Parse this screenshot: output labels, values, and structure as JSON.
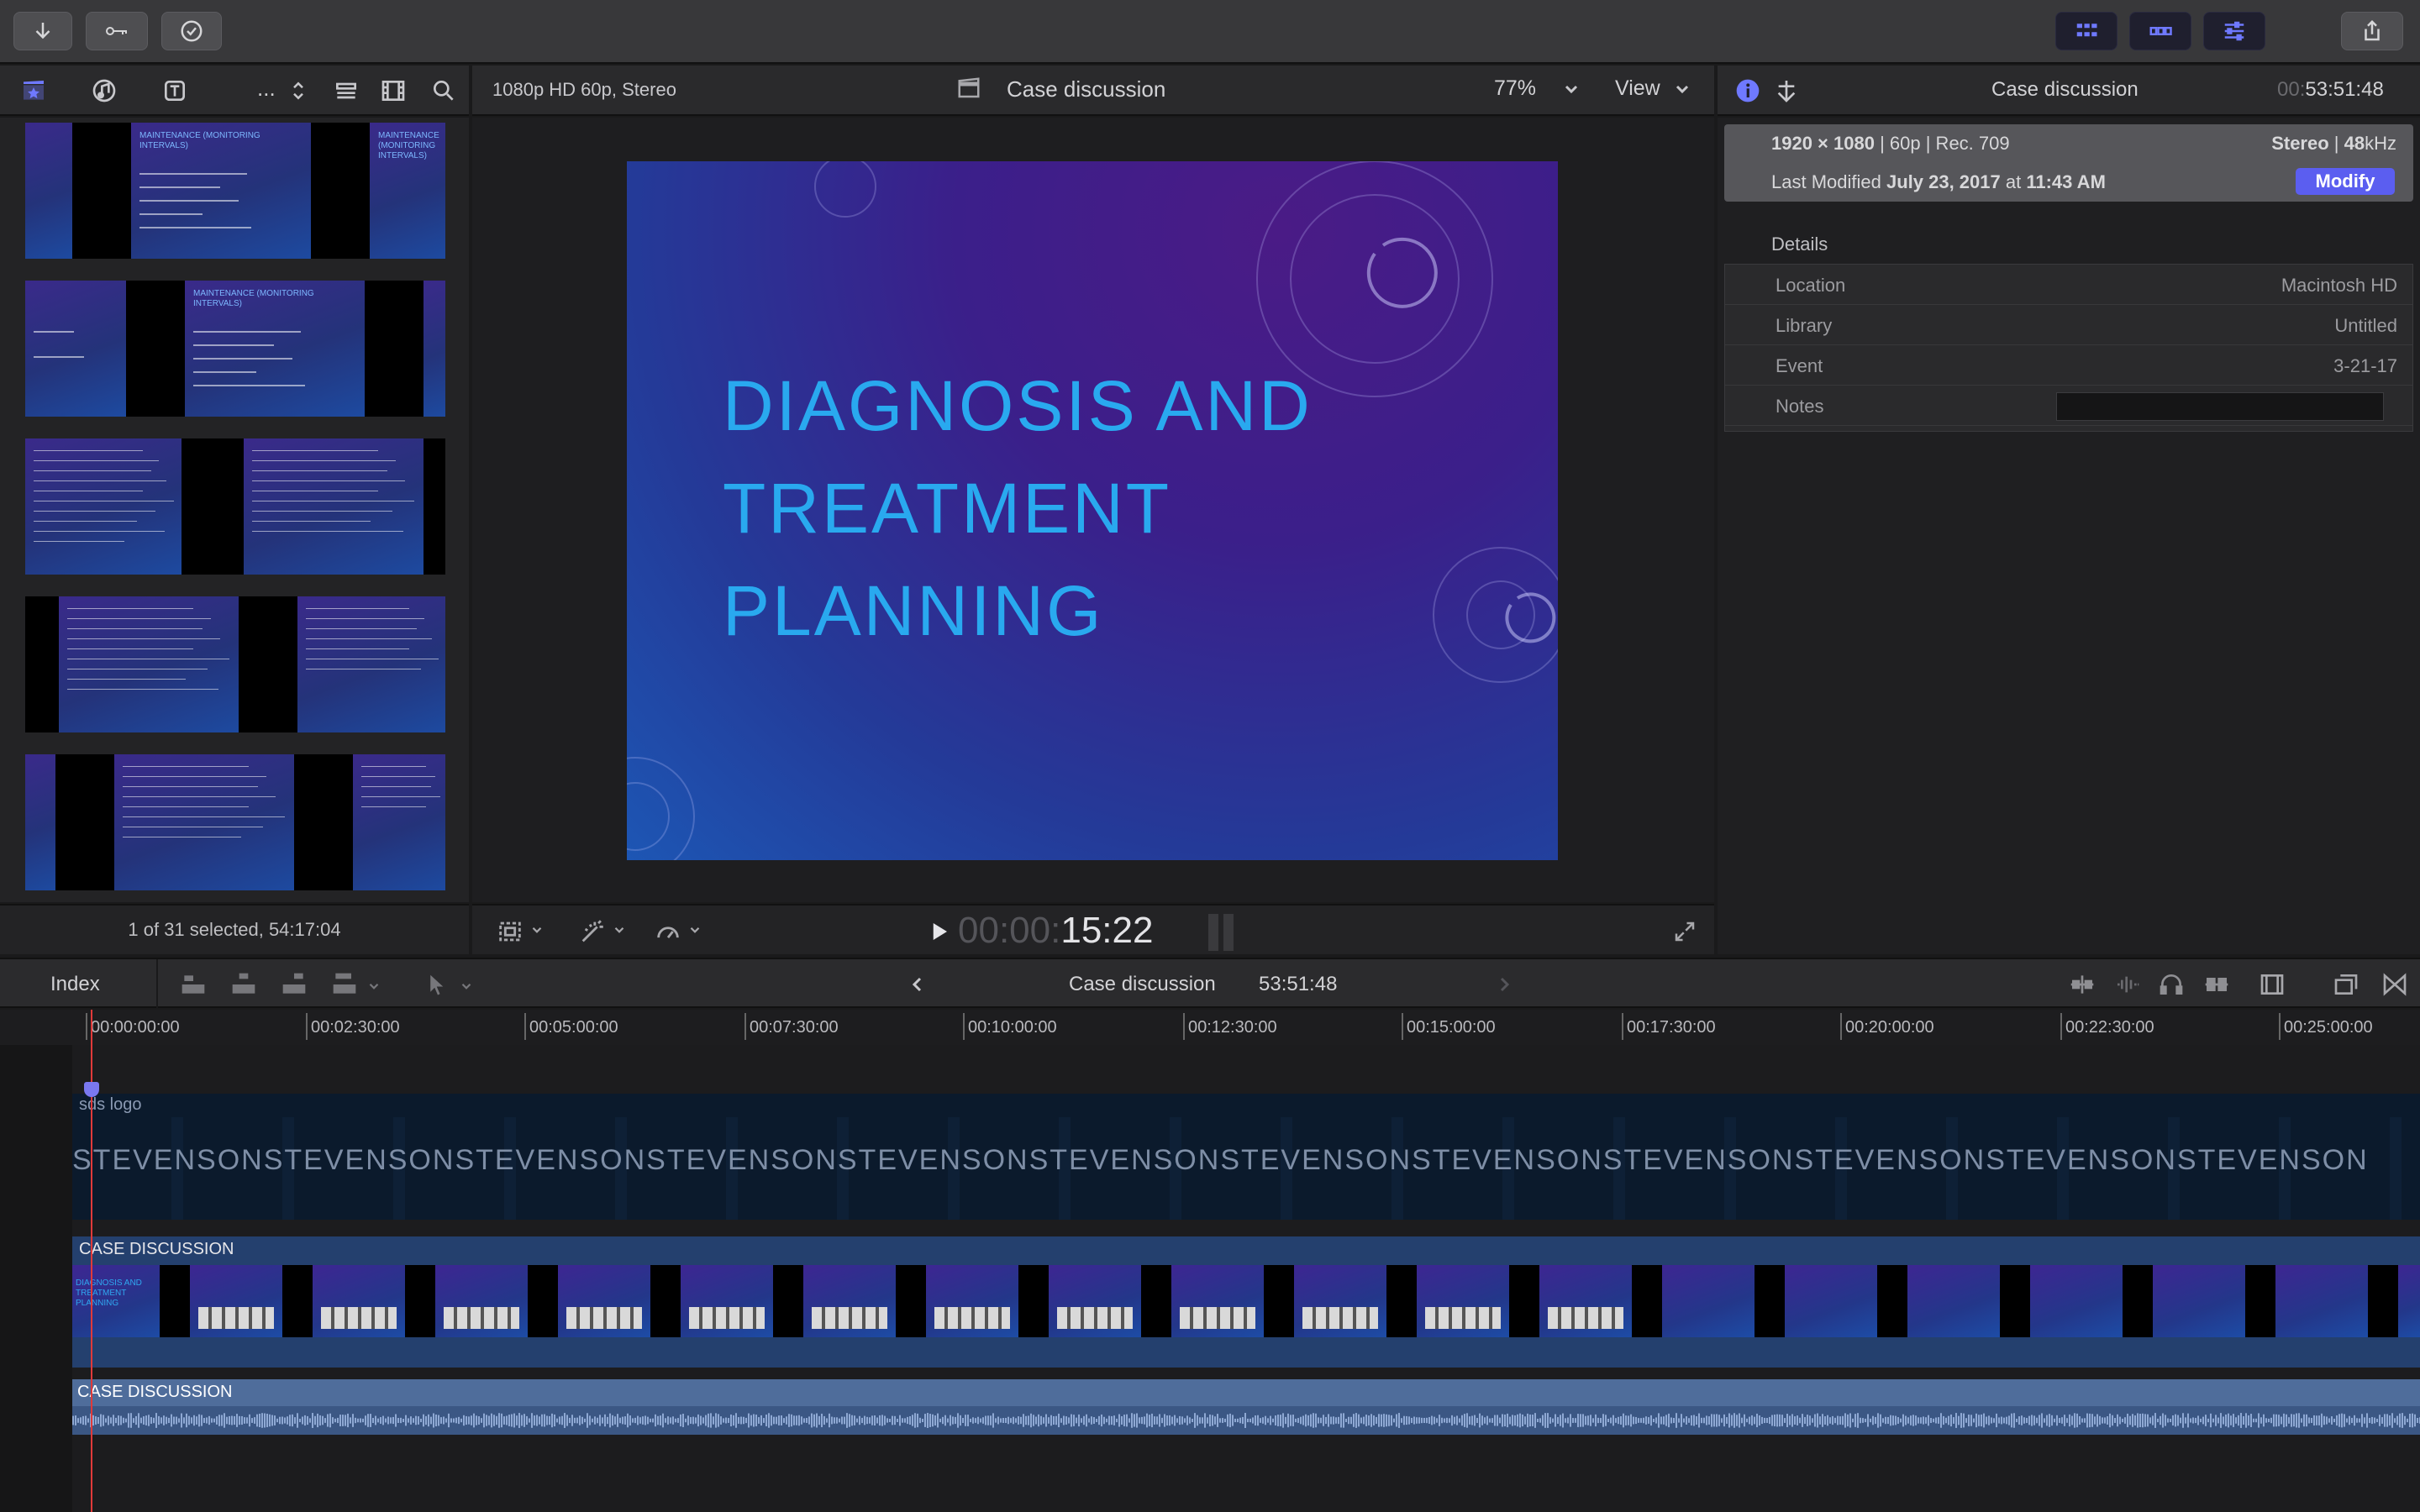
{
  "browser": {
    "status": "1 of 31 selected, 54:17:04",
    "more_label": "...",
    "thumbs": [
      {
        "title": "MAINTENANCE (MONITORING INTERVALS)"
      },
      {
        "title": "MAINTENANCE (MONITORING INTERVALS)"
      },
      {
        "title": ""
      },
      {
        "title": ""
      },
      {
        "title": ""
      }
    ]
  },
  "viewer": {
    "format": "1080p HD 60p, Stereo",
    "title": "Case discussion",
    "zoom": "77%",
    "view_label": "View",
    "slide_title_lines": [
      "DIAGNOSIS AND",
      "TREATMENT",
      "PLANNING"
    ],
    "timecode_dim": "00:00:",
    "timecode_main": "15:22"
  },
  "inspector": {
    "title": "Case discussion",
    "duration_dim": "00:",
    "duration_main": "53:51:48",
    "resolution": "1920 × 1080",
    "frame_info": " | 60p | Rec. 709",
    "audio_main": "Stereo",
    "audio_sep": " | ",
    "audio_rate": "48",
    "audio_unit": "kHz",
    "modified_label": "Last Modified ",
    "modified_date": "July 23, 2017",
    "modified_at": " at ",
    "modified_time": "11:43 AM",
    "modify_button": "Modify",
    "details_heading": "Details",
    "details": [
      {
        "key": "Location",
        "value": "Macintosh HD"
      },
      {
        "key": "Library",
        "value": "Untitled"
      },
      {
        "key": "Event",
        "value": "3-21-17"
      },
      {
        "key": "Notes",
        "value": ""
      }
    ]
  },
  "timeline": {
    "index_label": "Index",
    "project_name": "Case discussion",
    "project_duration": "53:51:48",
    "ruler_ticks": [
      "00:00:00:00",
      "00:02:30:00",
      "00:05:00:00",
      "00:07:30:00",
      "00:10:00:00",
      "00:12:30:00",
      "00:15:00:00",
      "00:17:30:00",
      "00:20:00:00",
      "00:22:30:00",
      "00:25:00:00"
    ],
    "logo_lane_label": "sds logo",
    "logo_text": "STEVENSON",
    "video_clip_label": "CASE DISCUSSION",
    "audio_clip_label": "CASE DISCUSSION",
    "video_first_thumb_text": "DIAGNOSIS AND TREATMENT PLANNING"
  },
  "colors": {
    "accent": "#6f79ff",
    "playhead": "#e03a3a",
    "slide_title": "#29a9ef",
    "modify_button": "#5b5ef0"
  }
}
